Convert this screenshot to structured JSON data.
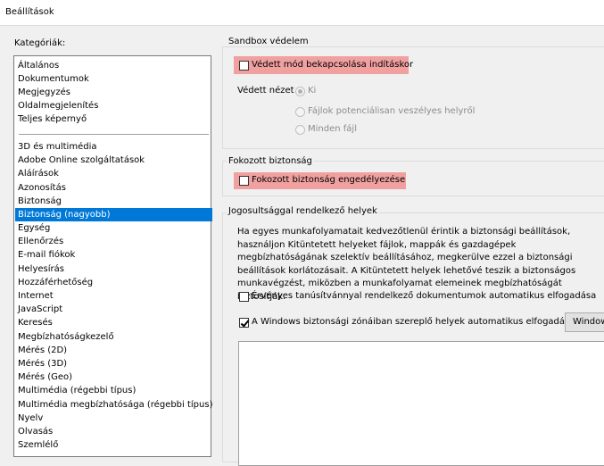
{
  "window": {
    "title": "Beállítások"
  },
  "categories": {
    "label": "Kategóriák:",
    "top_items": [
      "Általános",
      "Dokumentumok",
      "Megjegyzés",
      "Oldalmegjelenítés",
      "Teljes képernyő"
    ],
    "items": [
      "3D és multimédia",
      "Adobe Online szolgáltatások",
      "Aláírások",
      "Azonosítás",
      "Biztonság",
      "Biztonság (nagyobb)",
      "Egység",
      "Ellenőrzés",
      "E-mail fiókok",
      "Helyesírás",
      "Hozzáférhetőség",
      "Internet",
      "JavaScript",
      "Keresés",
      "Megbízhatóságkezelő",
      "Mérés (2D)",
      "Mérés (3D)",
      "Mérés (Geo)",
      "Multimédia (régebbi típus)",
      "Multimédia megbízhatósága (régebbi típus)",
      "Nyelv",
      "Olvasás",
      "Szemlélő"
    ],
    "selected": "Biztonság (nagyobb)"
  },
  "sandbox": {
    "title": "Sandbox védelem",
    "protected_mode_label": "Védett mód bekapcsolása indításkor",
    "protected_mode_checked": false,
    "protected_view_label": "Védett nézet",
    "options": [
      "Ki",
      "Fájlok potenciálisan veszélyes helyről",
      "Minden fájl"
    ],
    "selected_option": "Ki"
  },
  "enhanced": {
    "title": "Fokozott biztonság",
    "enable_label": "Fokozott biztonság engedélyezése",
    "enable_checked": false
  },
  "privileged": {
    "title": "Jogosultsággal rendelkező helyek",
    "description": "Ha egyes munkafolyamatait kedvezőtlenül érintik a biztonsági beállítások, használjon Kitüntetett helyeket fájlok, mappák és gazdagépek megbízhatóságának szelektív beállításához, megkerülve ezzel a biztonsági beállítások korlátozásait. A Kitüntetett helyek lehetővé teszik a biztonságos munkavégzést, miközben a munkafolyamat elemeinek megbízhatóságát biztosítják.",
    "certified_label": "Érvényes tanúsítvánnyal rendelkező dokumentumok automatikus elfogadása",
    "certified_checked": false,
    "windows_zone_label": "A Windows biztonsági zónáiban szereplő helyek automatikus elfogadása",
    "windows_zone_checked": true,
    "windows_button_label": "Windows"
  },
  "colors": {
    "highlight": "#f1a0a0",
    "selection": "#0078d7"
  }
}
